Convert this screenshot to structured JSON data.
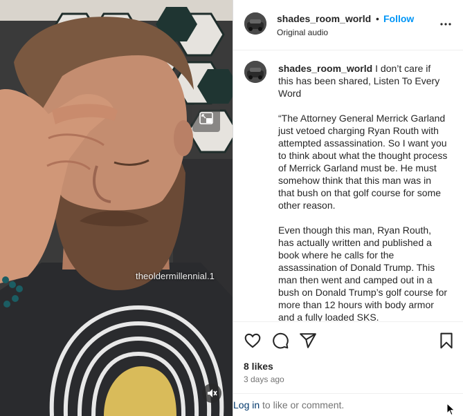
{
  "video": {
    "watermark": "theoldermillennial.1",
    "pip_icon": "picture-in-picture-icon",
    "mute_icon": "muted-speaker-icon"
  },
  "header": {
    "username": "shades_room_world",
    "separator": "•",
    "follow_label": "Follow",
    "audio_label": "Original audio",
    "more_icon": "more-horizontal-icon"
  },
  "caption": {
    "username": "shades_room_world",
    "text": "I don’t care if this has been shared, Listen To Every Word\n\n“The Attorney General Merrick Garland just vetoed charging Ryan Routh with attempted assassination. So I want you to think about what the thought process of Merrick Garland must be. He must somehow think that this man was in that bush on that golf course for some other reason.\n\nEven though this man, Ryan Routh, has actually written and published a book where he calls for the assassination of Donald Trump. This man then went and camped out in a bush on Donald Trump’s golf course for more than 12 hours with body armor and a fully loaded SKS."
  },
  "actions": {
    "like_icon": "heart-icon",
    "comment_icon": "comment-icon",
    "share_icon": "share-icon",
    "save_icon": "bookmark-icon",
    "likes": "8 likes",
    "date": "3 days ago"
  },
  "login": {
    "link": "Log in",
    "rest": " to like or comment."
  },
  "colors": {
    "accent": "#0095f6",
    "link_dark": "#00376b",
    "muted_text": "#737373",
    "divider": "#efefef"
  }
}
